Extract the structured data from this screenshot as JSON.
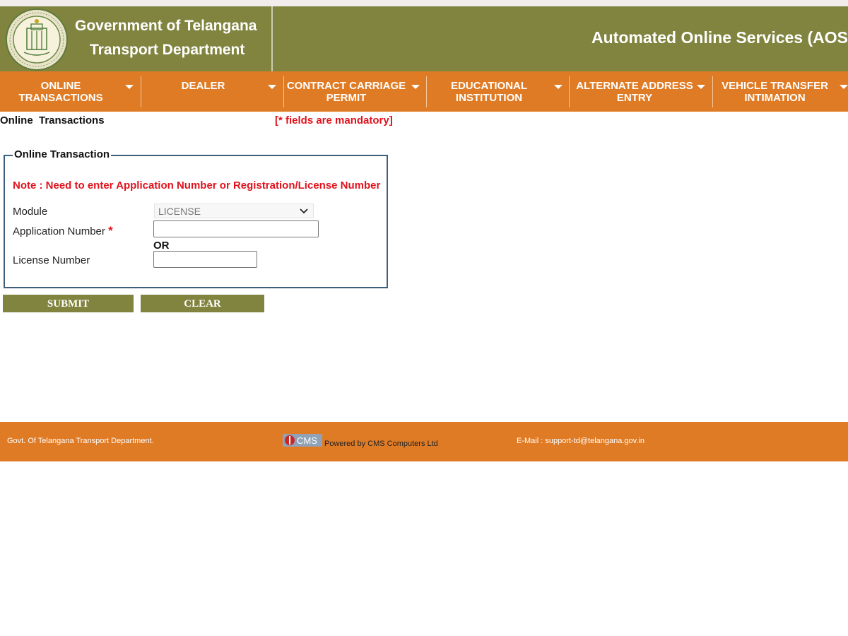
{
  "header": {
    "gov_title": "Government of Telangana",
    "dept_title": "Transport Department",
    "service_title": "Automated Online Services (AOS"
  },
  "nav": {
    "items": [
      {
        "label": "ONLINE\nTRANSACTIONS"
      },
      {
        "label": "DEALER"
      },
      {
        "label": "CONTRACT CARRIAGE\nPERMIT"
      },
      {
        "label": "EDUCATIONAL\nINSTITUTION"
      },
      {
        "label": "ALTERNATE ADDRESS\nENTRY"
      },
      {
        "label": "VEHICLE TRANSFER\nINTIMATION"
      }
    ]
  },
  "page": {
    "title": "Online  Transactions",
    "mandatory_note": "[* fields are mandatory]"
  },
  "form": {
    "legend": "Online Transaction",
    "note": "Note : Need to enter Application Number or Registration/License Number",
    "module_label": "Module",
    "module_value": "LICENSE",
    "application_label": "Application Number",
    "required_mark": "*",
    "application_value": "",
    "or_text": "OR",
    "license_label": "License Number",
    "license_value": ""
  },
  "buttons": {
    "submit": "SUBMIT",
    "clear": "CLEAR"
  },
  "footer": {
    "left": "Govt. Of Telangana Transport Department.",
    "logo_text": "CMS",
    "powered": "Powered by CMS Computers Ltd",
    "email": "E-Mail : support-td@telangana.gov.in"
  },
  "colors": {
    "header_olive": "#81843f",
    "nav_orange": "#e07b25",
    "required_red": "#e0121c",
    "fieldset_border": "#3d5f7c"
  },
  "icons": [
    "telangana-emblem-icon",
    "chevron-down-icon",
    "caret-down-icon",
    "cms-logo-icon"
  ]
}
